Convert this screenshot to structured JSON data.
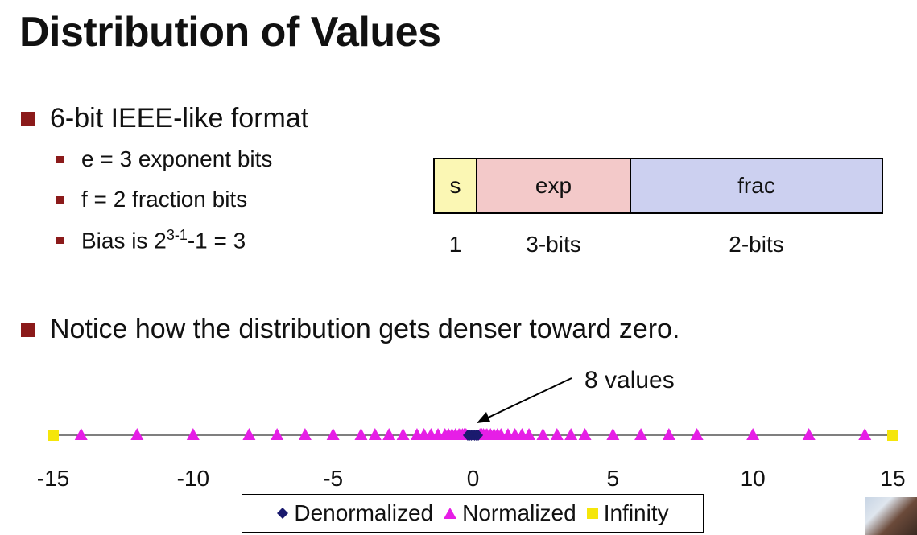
{
  "title": "Distribution of Values",
  "bullets": {
    "format": "6-bit IEEE-like format",
    "exp_bits": "e = 3 exponent bits",
    "frac_bits": "f = 2 fraction bits",
    "bias_prefix": "Bias is 2",
    "bias_sup": "3-1",
    "bias_suffix": "-1 = 3",
    "notice": "Notice how the distribution gets denser toward zero."
  },
  "fields": [
    {
      "label": "s",
      "width": "1",
      "color": "#fbf7b4"
    },
    {
      "label": "exp",
      "width": "3-bits",
      "color": "#f3c9c9"
    },
    {
      "label": "frac",
      "width": "2-bits",
      "color": "#ccd0f0"
    }
  ],
  "annotation": "8 values",
  "legend": {
    "denormalized": "Denormalized",
    "normalized": "Normalized",
    "infinity": "Infinity"
  },
  "colors": {
    "bullet": "#8b1a1a",
    "denormalized": "#1a1a6e",
    "normalized": "#e61ee6",
    "infinity": "#f5e60a"
  },
  "chart_data": {
    "type": "scatter",
    "xlim": [
      -15,
      15
    ],
    "xticks": [
      -15,
      -10,
      -5,
      0,
      5,
      10,
      15
    ],
    "series": [
      {
        "name": "Denormalized",
        "values": [
          -0.1875,
          -0.125,
          -0.0625,
          0,
          0,
          0.0625,
          0.125,
          0.1875
        ]
      },
      {
        "name": "Normalized",
        "values": [
          -14,
          -12,
          -10,
          -8,
          -7,
          -6,
          -5,
          -4,
          -3.5,
          -3,
          -2.5,
          -2,
          -1.75,
          -1.5,
          -1.25,
          -1,
          -0.875,
          -0.75,
          -0.625,
          -0.5,
          -0.4375,
          -0.375,
          -0.3125,
          -0.25,
          0.25,
          0.3125,
          0.375,
          0.4375,
          0.5,
          0.625,
          0.75,
          0.875,
          1,
          1.25,
          1.5,
          1.75,
          2,
          2.5,
          3,
          3.5,
          4,
          5,
          6,
          7,
          8,
          10,
          12,
          14
        ]
      },
      {
        "name": "Infinity",
        "values": [
          -15,
          15
        ]
      }
    ]
  }
}
